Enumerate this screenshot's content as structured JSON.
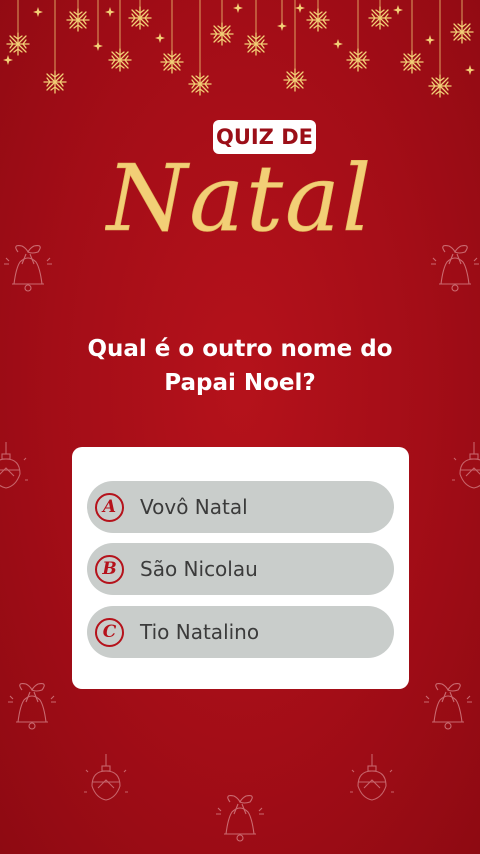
{
  "title": {
    "badge": "QUIZ DE",
    "word": "Natal"
  },
  "question": {
    "line1": "Qual é o outro nome do",
    "line2": "Papai Noel?"
  },
  "options": [
    {
      "letter": "A",
      "text": "Vovô Natal"
    },
    {
      "letter": "B",
      "text": "São Nicolau"
    },
    {
      "letter": "C",
      "text": "Tio Natalino"
    }
  ],
  "colors": {
    "background": "#a30d17",
    "gold": "#f2cf76",
    "option_bg": "#c9cdcb",
    "accent": "#b5121b"
  },
  "icons": [
    "snowflake-icon",
    "bell-icon",
    "ornament-icon"
  ]
}
